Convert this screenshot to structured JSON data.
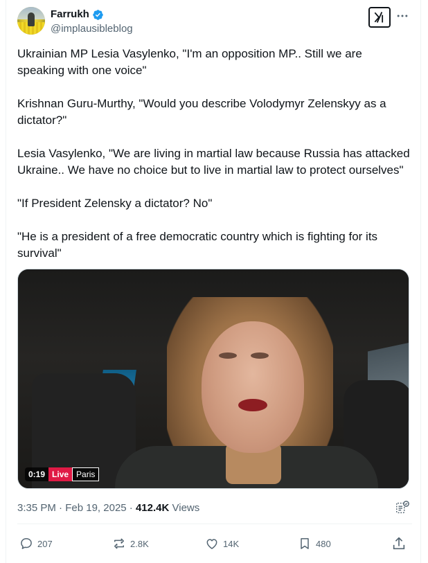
{
  "author": {
    "display_name": "Farrukh",
    "handle": "@implausibleblog",
    "verified": true,
    "avatar_icon": "avatar-image"
  },
  "tweet": {
    "paragraphs": [
      "Ukrainian MP Lesia Vasylenko, \"I'm an opposition MP.. Still we are speaking with one voice\"",
      "Krishnan Guru-Murthy, \"Would you describe Volodymyr Zelenskyy as a dictator?\"",
      "Lesia Vasylenko, \"We are living in martial law because Russia has attacked Ukraine.. We have no choice but to live in martial law to protect ourselves\"",
      "\"If President Zelensky a dictator? No\"",
      "\"He is a president of a free democratic country which is fighting for its survival\""
    ]
  },
  "video": {
    "elapsed": "0:19",
    "live_label": "Live",
    "location": "Paris"
  },
  "meta": {
    "time": "3:35 PM",
    "separator": "·",
    "date": "Feb 19, 2025",
    "views_count": "412.4K",
    "views_label": "Views"
  },
  "actions": {
    "replies": "207",
    "reposts": "2.8K",
    "likes": "14K",
    "bookmarks": "480"
  },
  "colors": {
    "text": "#0f1419",
    "secondary": "#536471",
    "verified": "#1d9bf0",
    "live": "#e01a45"
  }
}
